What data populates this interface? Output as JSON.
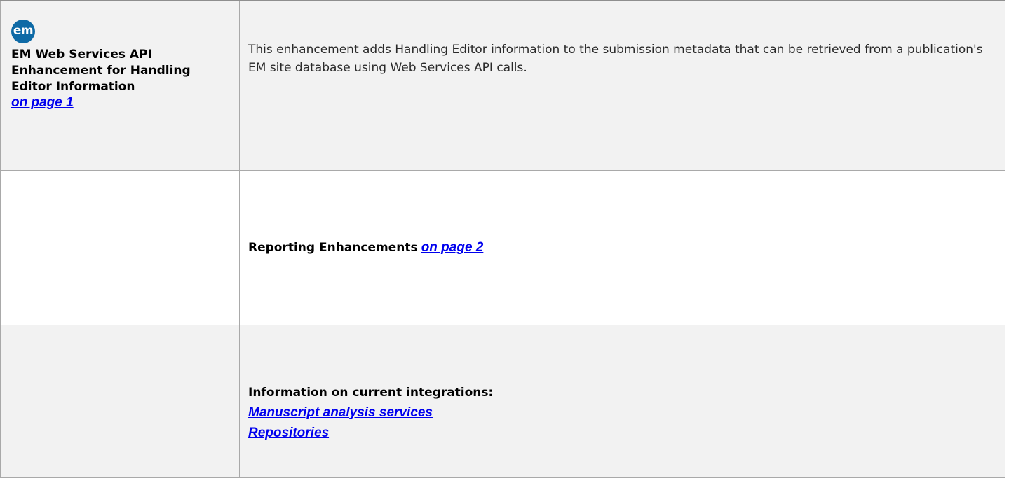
{
  "rows": [
    {
      "logo_text": "em",
      "title": "EM Web Services API Enhancement for Handling Editor Information",
      "link": "on page 1",
      "description": "This enhancement adds Handling Editor information to the submission metadata that can be retrieved from a publication's EM site database using Web Services API calls."
    },
    {
      "text": "Reporting Enhancements",
      "link": "on page 2"
    },
    {
      "heading": "Information on current integrations:",
      "links": [
        "Manuscript analysis services",
        "Repositories"
      ]
    }
  ],
  "colors": {
    "row_gray": "#f2f2f2",
    "logo": "#0e6aa6",
    "link": "#0000ee",
    "border": "#a9a9a9"
  }
}
